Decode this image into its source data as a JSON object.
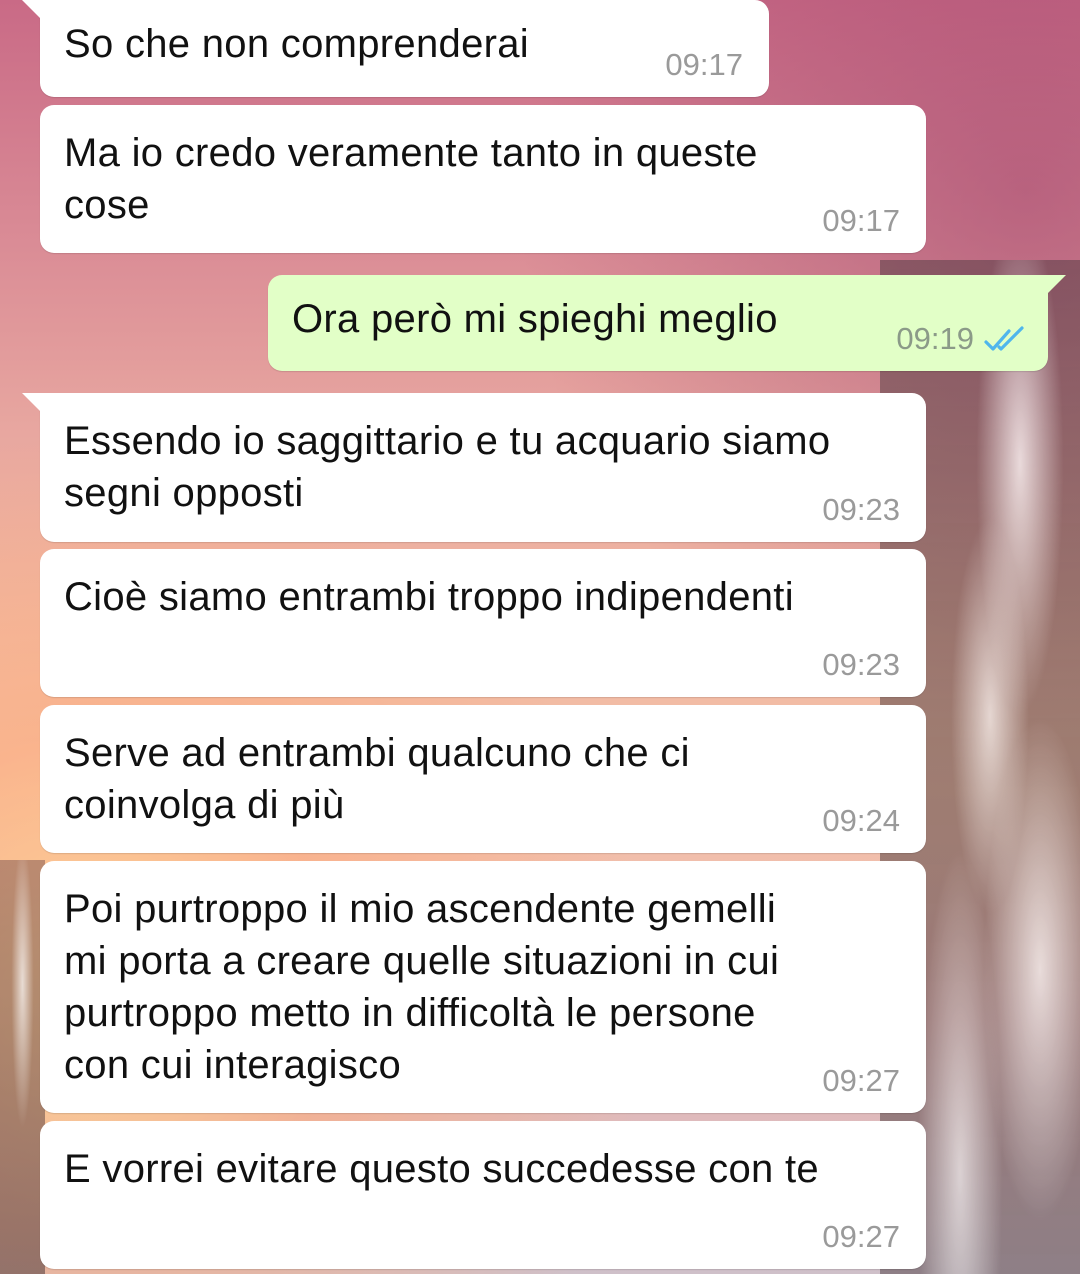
{
  "conversation": {
    "messages": [
      {
        "direction": "in",
        "text": "So che non comprenderai",
        "time": "09:17"
      },
      {
        "direction": "in",
        "text": "Ma io credo veramente tanto in queste\ncose",
        "time": "09:17"
      },
      {
        "direction": "out",
        "text": "Ora però mi spieghi meglio",
        "time": "09:19",
        "status": "read"
      },
      {
        "direction": "in",
        "text": "Essendo io saggittario e tu acquario siamo\nsegni opposti",
        "time": "09:23"
      },
      {
        "direction": "in",
        "text": "Cioè siamo entrambi troppo indipendenti",
        "time": "09:23"
      },
      {
        "direction": "in",
        "text": "Serve ad entrambi qualcuno che ci\ncoinvolga di più",
        "time": "09:24"
      },
      {
        "direction": "in",
        "text": "Poi purtroppo il mio ascendente gemelli\nmi porta a creare quelle situazioni in cui\npurtroppo metto in difficoltà le persone\ncon cui interagisco",
        "time": "09:27"
      },
      {
        "direction": "in",
        "text": "E vorrei evitare questo succedesse con te",
        "time": "09:27"
      }
    ]
  },
  "colors": {
    "incoming_bubble": "#ffffff",
    "outgoing_bubble": "#e2ffc7",
    "read_ticks": "#4fb6ec",
    "timestamp": "#9a9a9a"
  }
}
